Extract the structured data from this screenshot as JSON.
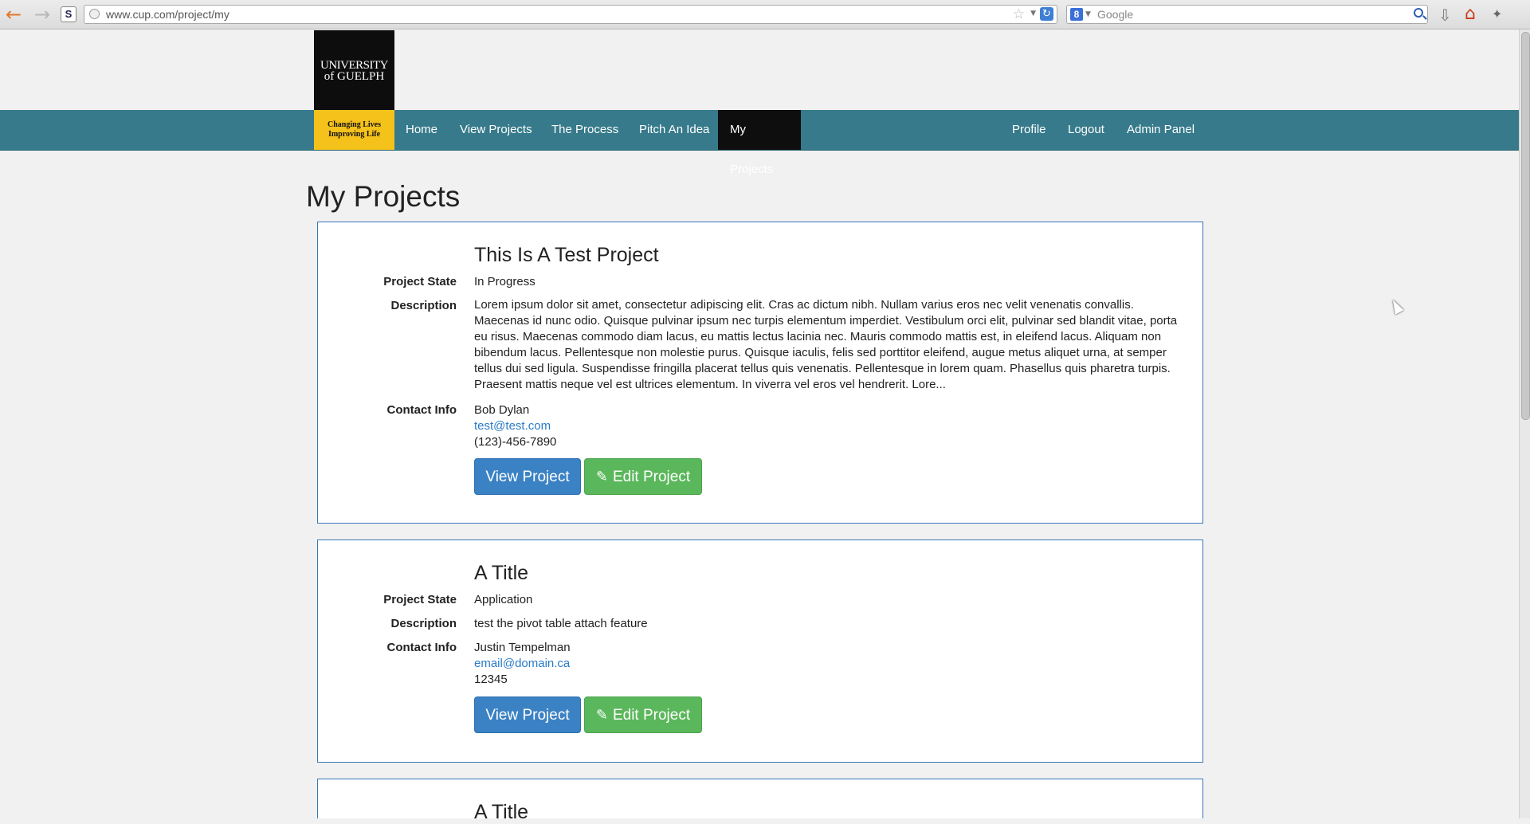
{
  "browser": {
    "url": "www.cup.com/project/my",
    "search_placeholder": "Google",
    "search_engine_icon": "8"
  },
  "logo": {
    "line1": "UNIVERSITY",
    "line2": "of GUELPH",
    "tagline1": "Changing Lives",
    "tagline2": "Improving Life"
  },
  "nav": {
    "home": "Home",
    "view_projects": "View Projects",
    "the_process": "The Process",
    "pitch_an_idea": "Pitch An Idea",
    "my_projects": "My Projects",
    "profile": "Profile",
    "logout": "Logout",
    "admin_panel": "Admin Panel"
  },
  "page": {
    "title": "My Projects"
  },
  "labels": {
    "project_state": "Project State",
    "description": "Description",
    "contact_info": "Contact Info",
    "view_button": "View Project",
    "edit_button": "Edit Project"
  },
  "projects": [
    {
      "title": "This Is A Test Project",
      "state": "In Progress",
      "description": "Lorem ipsum dolor sit amet, consectetur adipiscing elit. Cras ac dictum nibh. Nullam varius eros nec velit venenatis convallis. Maecenas id nunc odio. Quisque pulvinar ipsum nec turpis elementum imperdiet. Vestibulum orci elit, pulvinar sed blandit vitae, porta eu risus. Maecenas commodo diam lacus, eu mattis lectus lacinia nec. Mauris commodo mattis est, in eleifend lacus. Aliquam non bibendum lacus. Pellentesque non molestie purus. Quisque iaculis, felis sed porttitor eleifend, augue metus aliquet urna, at semper tellus dui sed ligula. Suspendisse fringilla placerat tellus quis venenatis. Pellentesque in lorem quam. Phasellus quis pharetra turpis. Praesent mattis neque vel est ultrices elementum. In viverra vel eros vel hendrerit. Lore...",
      "contact_name": "Bob Dylan",
      "contact_email": "test@test.com",
      "contact_phone": "(123)-456-7890"
    },
    {
      "title": "A Title",
      "state": "Application",
      "description": "test the pivot table attach feature",
      "contact_name": "Justin Tempelman",
      "contact_email": "email@domain.ca",
      "contact_phone": "12345"
    },
    {
      "title": "A Title"
    }
  ],
  "colors": {
    "nav_bg": "#367a8b",
    "nav_active": "#0e0e0e",
    "btn_primary": "#3b82c4",
    "btn_success": "#5bb75b",
    "card_border": "#3979b8",
    "link": "#2a7bc7"
  }
}
